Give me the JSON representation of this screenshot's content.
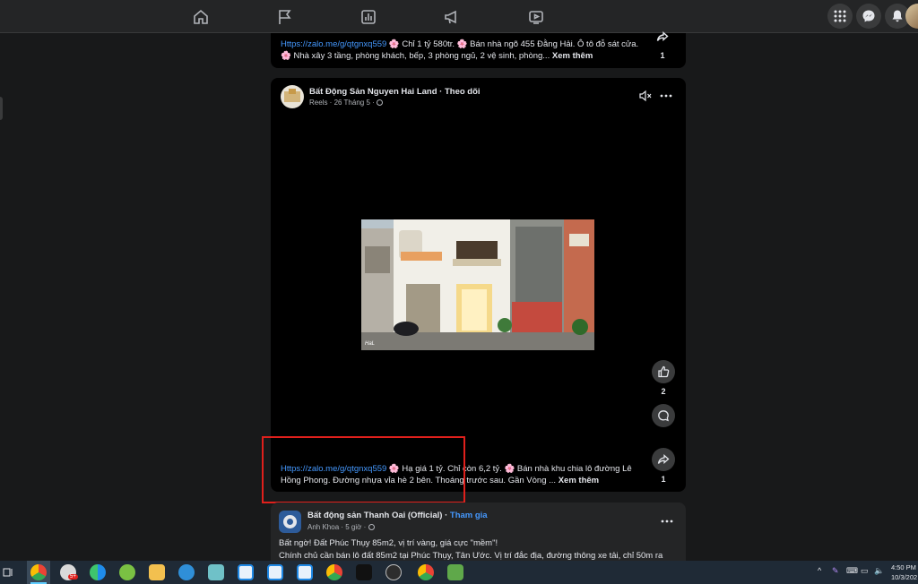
{
  "nav": {
    "icons": [
      "home-icon",
      "flag-icon",
      "chart-icon",
      "megaphone-icon",
      "video-icon"
    ],
    "right_icons": [
      "grid-menu-icon",
      "messenger-icon",
      "bell-icon"
    ]
  },
  "post_top": {
    "caption_link": "Https://zalo.me/g/qtgnxq559",
    "caption_text": " 🌸 Chỉ 1 tỷ 580tr. 🌸 Bán nhà ngõ 455 Đằng Hải. Ô tô đỗ sát cửa. 🌸 Nhà xây 3 tầng, phòng khách, bếp, 3 phòng ngủ, 2 vệ sinh, phòng...",
    "see_more": "Xem thêm",
    "share_count": "1"
  },
  "post_reel": {
    "page_name": "Bất Động Sản Nguyen Hai Land",
    "follow": "Theo dõi",
    "meta": "Reels · 26 Tháng 5 ·",
    "caption_link": "Https://zalo.me/g/qtgnxq559",
    "caption_text": " 🌸 Hạ giá 1 tỷ. Chỉ còn 6,2 tỷ. 🌸 Bán nhà khu chia lô đường Lê Hồng Phong. Đường nhựa vỉa hè 2 bên. Thoáng trước sau. Gần Vòng ...",
    "see_more": "Xem thêm",
    "like_count": "2",
    "share_count": "1",
    "video_watermark": "HaL",
    "highlight_color": "#e0201c"
  },
  "post_bottom": {
    "page_name": "Bất động sản Thanh Oai (Official)",
    "join": "Tham gia",
    "author_meta": "Anh Khoa · 5 giờ ·",
    "line1": "Bất ngờ! Đất Phúc Thụy 85m2, vị trí vàng, giá cực \"mềm\"!",
    "line2": "Chính chủ cần bán lô đất 85m2 tại Phúc Thụy, Tân Ước. Vị trí đắc địa, đường thông xe tải, chỉ 50m ra"
  },
  "taskbar": {
    "time": "4:50 PM",
    "date": "10/3/202",
    "badge": "5+"
  }
}
